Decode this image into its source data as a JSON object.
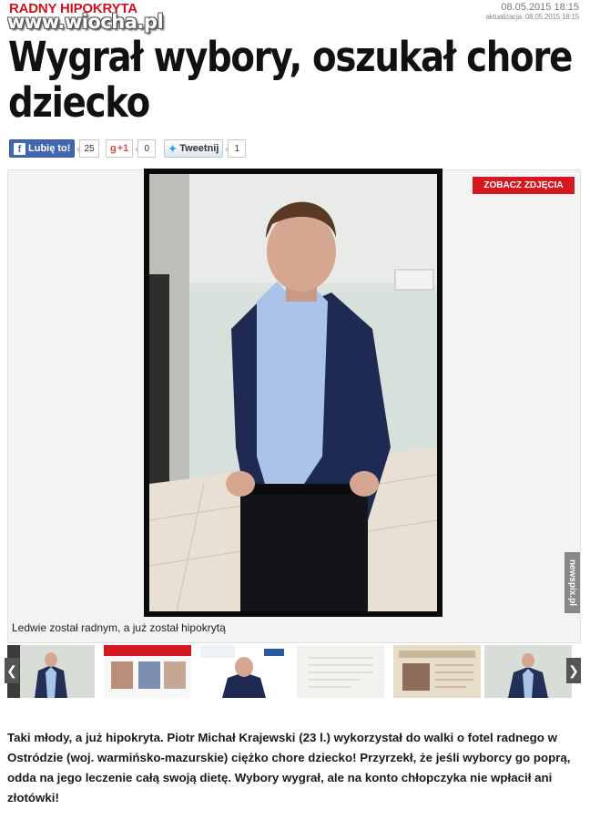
{
  "header": {
    "kicker": "RADNY HIPOKRYTA",
    "watermark": "www.wiocha.pl",
    "date": "08.05.2015 18:15",
    "updated": "aktualizacja: 08.05.2015 18:15"
  },
  "headline": "Wygrał wybory, oszukał chore dziecko",
  "social": {
    "facebook": {
      "label": "Lubię to!",
      "count": "25",
      "icon": "facebook-icon"
    },
    "gplus": {
      "label": "+1",
      "count": "0",
      "icon": "google-plus-icon"
    },
    "twitter": {
      "label": "Tweetnij",
      "count": "1",
      "icon": "twitter-bird-icon"
    }
  },
  "gallery": {
    "button_label": "ZOBACZ ZDJĘCIA",
    "credit": "newspix.pl",
    "caption": "Ledwie został radnym, a już został hipokrytą",
    "prev_icon": "chevron-left-icon",
    "next_icon": "chevron-right-icon"
  },
  "article": {
    "lead": "Taki młody, a już hipokryta. Piotr Michał Krajewski (23 l.) wykorzystał do walki o fotel radnego w Ostródzie (woj. warmińsko-mazurskie) ciężko chore dziecko! Przyrzekł, że jeśli wyborcy go poprą, odda na jego leczenie całą swoją dietę. Wybory wygrał, ale na konto chłopczyka nie wpłacił ani złotówki!"
  },
  "colors": {
    "accent": "#d51820",
    "kicker": "#d1121d",
    "facebook": "#4267b2",
    "twitter": "#1da1f2"
  }
}
